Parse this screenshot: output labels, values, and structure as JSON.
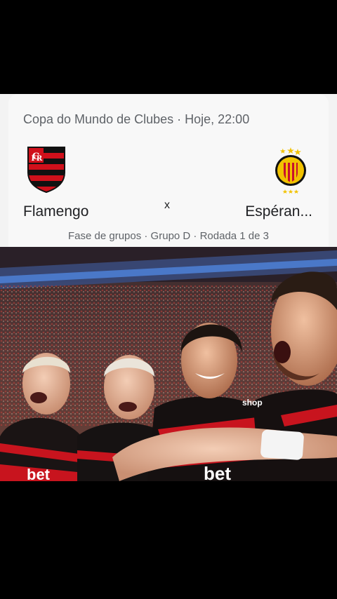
{
  "card": {
    "header": "Copa do Mundo de Clubes · Hoje, 22:00",
    "home_team": {
      "name": "Flamengo",
      "crest": "flamengo-crest"
    },
    "away_team": {
      "name": "Espéran...",
      "crest": "esperance-crest"
    },
    "separator": "x",
    "footer": "Fase de grupos · Grupo D · Rodada 1 de 3"
  },
  "photo": {
    "jersey_text_sponsor": "bet",
    "jersey_text_maker": "shop"
  },
  "colors": {
    "flamengo_red": "#d0101b",
    "flamengo_black": "#111111",
    "esperance_yellow": "#f2c200",
    "esperance_red": "#c8102e"
  }
}
